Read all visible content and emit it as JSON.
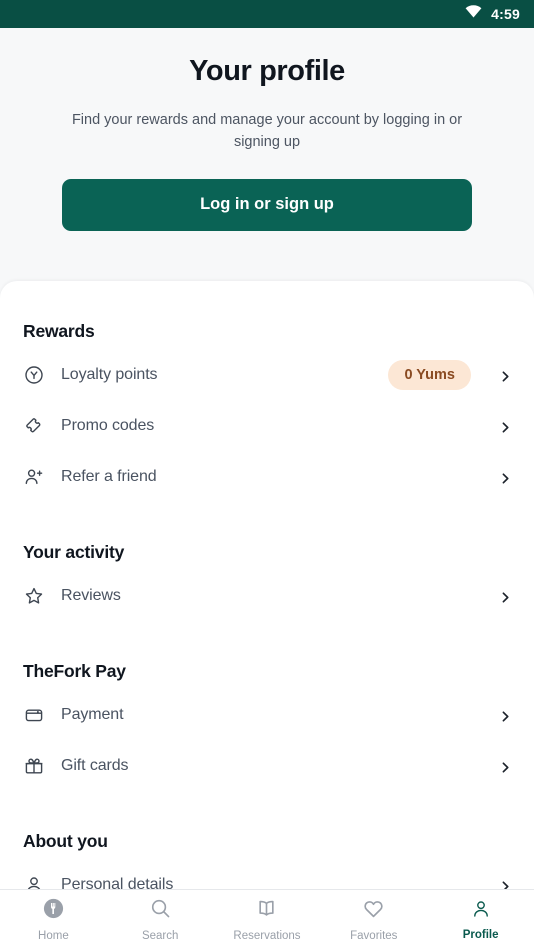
{
  "status_bar": {
    "time": "4:59",
    "wifi_icon": "wifi-icon"
  },
  "header": {
    "title": "Your profile",
    "subtitle": "Find your rewards and manage your account by logging in or signing up",
    "cta_label": "Log in or sign up"
  },
  "sections": [
    {
      "title": "Rewards",
      "rows": [
        {
          "label": "Loyalty points",
          "icon": "yums-circle-icon",
          "badge": "0 Yums"
        },
        {
          "label": "Promo codes",
          "icon": "ticket-icon",
          "badge": ""
        },
        {
          "label": "Refer a friend",
          "icon": "person-add-icon",
          "badge": ""
        }
      ]
    },
    {
      "title": "Your activity",
      "rows": [
        {
          "label": "Reviews",
          "icon": "star-icon",
          "badge": ""
        }
      ]
    },
    {
      "title": "TheFork Pay",
      "rows": [
        {
          "label": "Payment",
          "icon": "wallet-icon",
          "badge": ""
        },
        {
          "label": "Gift cards",
          "icon": "gift-icon",
          "badge": ""
        }
      ]
    },
    {
      "title": "About you",
      "rows": [
        {
          "label": "Personal details",
          "icon": "person-icon",
          "badge": ""
        }
      ]
    }
  ],
  "bottom_nav": {
    "items": [
      {
        "label": "Home",
        "icon": "fork-logo-icon",
        "active": false
      },
      {
        "label": "Search",
        "icon": "search-icon",
        "active": false
      },
      {
        "label": "Reservations",
        "icon": "book-icon",
        "active": false
      },
      {
        "label": "Favorites",
        "icon": "heart-icon",
        "active": false
      },
      {
        "label": "Profile",
        "icon": "person-icon",
        "active": true
      }
    ]
  },
  "colors": {
    "brand_green": "#0A6355",
    "status_bar_green": "#094F44",
    "active_nav": "#0A5A4E",
    "badge_bg": "#FCE7D5",
    "badge_text": "#8A4B22",
    "page_bg": "#F7F8F9",
    "title_text": "#10161F",
    "row_text": "#4A5361"
  }
}
